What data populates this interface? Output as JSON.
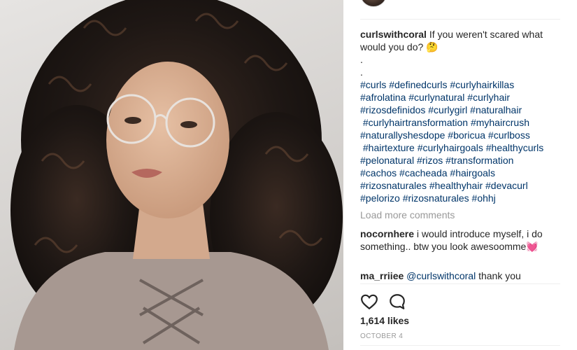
{
  "post": {
    "photo_icon": "portrait-photo",
    "author": "curlswithcoral",
    "caption_text": "If you weren't scared what would you do? 🤔",
    "caption_dots": [
      ".",
      "."
    ],
    "hashtag_lines": [
      "#curls #definedcurls #curlyhairkillas",
      "#afrolatina #curlynatural #curlyhair",
      "#rizosdefinidos #curlygirl #naturalhair",
      " #curlyhairtransformation #myhaircrush",
      "#naturallyshesdope #boricua #curlboss",
      " #hairtexture #curlyhairgoals #healthycurls",
      "#pelonatural #rizos #transformation",
      "#cachos #cacheada #hairgoals",
      "#rizosnaturales #healthyhair #devacurl",
      "#pelorizo #rizosnaturales #ohhj"
    ]
  },
  "comments": {
    "load_more": "Load more comments",
    "items": [
      {
        "user": "nocornhere",
        "mention": "",
        "text": "i would introduce myself, i do something.. btw you look awesoomme💓"
      },
      {
        "user": "ma_rriiee",
        "mention": "@curlswithcoral",
        "text": "thank you"
      }
    ]
  },
  "actions": {
    "like_icon": "heart-outline",
    "comment_icon": "speech-bubble"
  },
  "likes": "1,614 likes",
  "date": "OCTOBER 4",
  "colors": {
    "link": "#003569",
    "muted": "#999999",
    "text": "#262626",
    "divider": "#efefef"
  }
}
